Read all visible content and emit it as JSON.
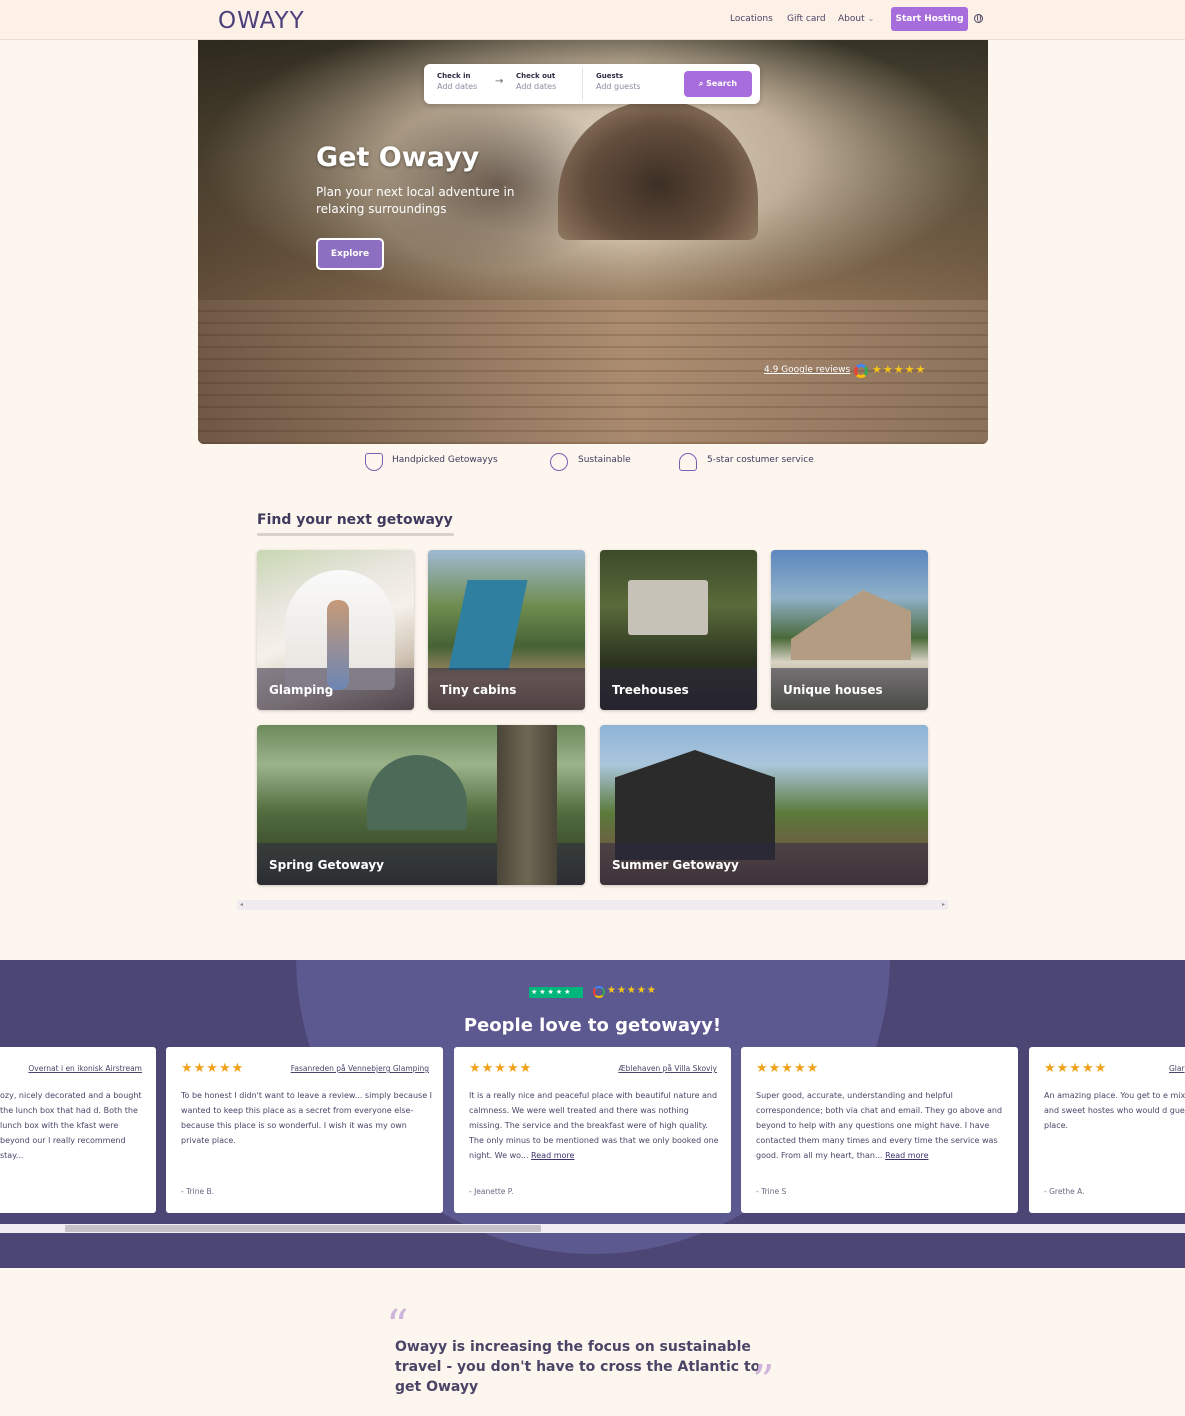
{
  "header": {
    "logo": "OWAYY",
    "nav": {
      "locations": "Locations",
      "gift_card": "Gift card",
      "about": "About"
    },
    "start_hosting": "Start Hosting"
  },
  "search": {
    "check_in_label": "Check in",
    "check_in_value": "Add dates",
    "check_out_label": "Check out",
    "check_out_value": "Add dates",
    "guests_label": "Guests",
    "guests_value": "Add guests",
    "button": "Search"
  },
  "hero": {
    "title": "Get Owayy",
    "subtitle": "Plan your next local adventure in relaxing surroundings",
    "explore": "Explore",
    "reviews_link": "4.9 Google reviews",
    "stars": "★★★★★"
  },
  "features": [
    {
      "label": "Handpicked Getowayys",
      "icon": "hand-star-icon"
    },
    {
      "label": "Sustainable",
      "icon": "globe-leaf-icon"
    },
    {
      "label": "5-star costumer service",
      "icon": "headset-icon"
    }
  ],
  "categories": {
    "title": "Find your next getowayy",
    "items": [
      "Glamping",
      "Tiny cabins",
      "Treehouses",
      "Unique houses",
      "Spring Getowayy",
      "Summer Getowayy"
    ]
  },
  "reviews": {
    "trustpilot_stars": "★★★★★",
    "google_stars": "★★★★★",
    "title": "People love to getowayy!",
    "cards": [
      {
        "stars": "★★★★★",
        "place": "Overnat i en ikonisk Airstream",
        "text": "ozy, nicely decorated and a bought the lunch box that had d. Both the lunch box with the kfast were beyond our l really recommend stay...",
        "more": "",
        "author": ""
      },
      {
        "stars": "★★★★★",
        "place": "Fasanreden på Vennebjerg Glamping",
        "text": "To be honest I didn't want to leave a review... simply because I wanted to keep this place as a secret from everyone else- because this place is so wonderful. I wish it was my own private place.",
        "more": "",
        "author": "- Trine B."
      },
      {
        "stars": "★★★★★",
        "place": "Æblehaven på Villa Skoviy",
        "text": "It is a really nice and peaceful place with beautiful nature and calmness. We were well treated and there was nothing missing. The service and the breakfast were of high quality. The only minus to be mentioned was that we only booked one night. We wo...",
        "more": "Read more",
        "author": "- Jeanette P."
      },
      {
        "stars": "★★★★★",
        "place": "",
        "text": "Super good, accurate, understanding and helpful correspondence; both via chat and email. They go above and beyond to help with any questions one might have. I have contacted them many times and every time the service was good. From all my heart, than...",
        "more": "Read more",
        "author": "- Trine S"
      },
      {
        "stars": "★★★★★",
        "place": "Glar",
        "text": "An amazing place. You get to e mixed with luxury and well-bei and sweet hostes who would d guest enjoys a nice stay. We ca place.",
        "more": "",
        "author": "- Grethe A."
      }
    ]
  },
  "quote": {
    "open_mark": "“",
    "text": "Owayy is increasing the focus on sustainable travel - you don't have to cross the Atlantic to get Owayy",
    "close_mark": "”"
  },
  "colors": {
    "accent": "#a86ddc",
    "brand_dark": "#4b4673",
    "background": "#fdf6ef"
  }
}
